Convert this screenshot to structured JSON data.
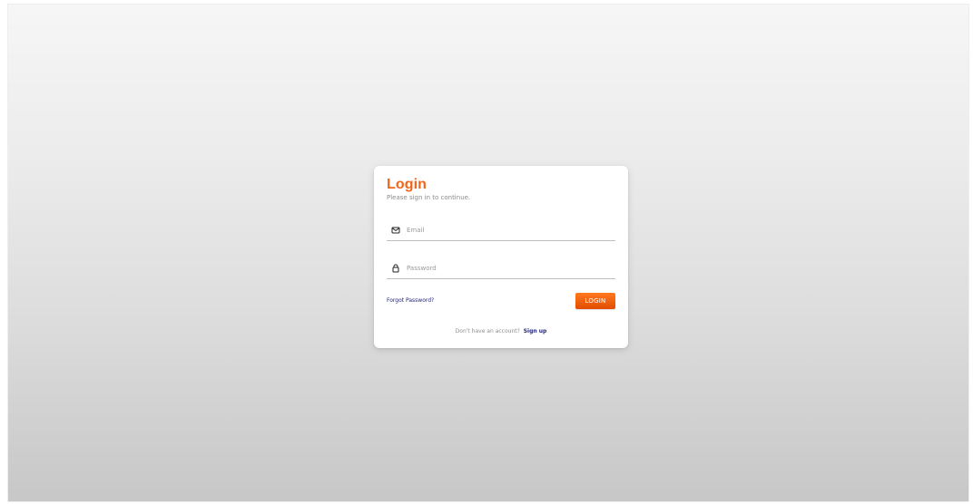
{
  "login": {
    "title": "Login",
    "subtitle": "Please sign in to continue.",
    "email": {
      "placeholder": "Email",
      "value": "",
      "icon": "mail-icon"
    },
    "password": {
      "placeholder": "Password",
      "value": "",
      "icon": "lock-icon"
    },
    "forgot_password": "Forgot Password?",
    "button": "LOGIN",
    "signup_prompt": "Don't have an account?",
    "signup_link": "Sign up"
  },
  "colors": {
    "accent": "#f2661b",
    "button_start": "#ff7a1f",
    "button_end": "#e24b00",
    "link": "#24257a",
    "muted_text": "#8b8b8b",
    "divider": "#bdbdbd",
    "card": "#ffffff"
  }
}
